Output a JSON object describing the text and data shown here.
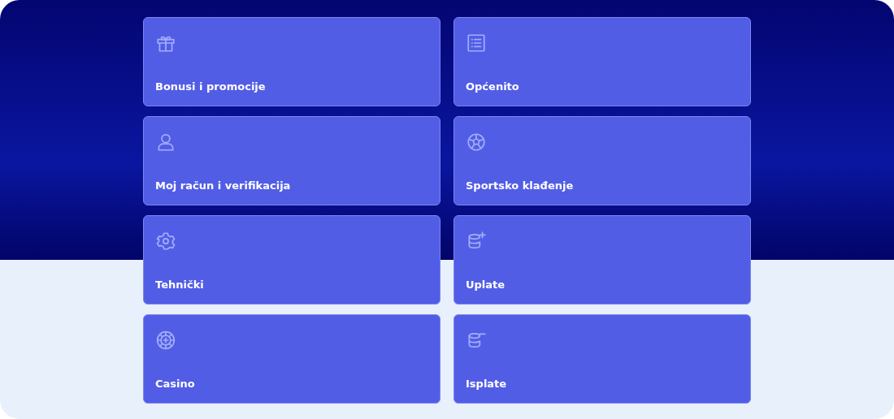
{
  "categories": [
    {
      "label": "Bonusi i promocije"
    },
    {
      "label": "Općenito"
    },
    {
      "label": "Moj račun i verifikacija"
    },
    {
      "label": "Sportsko klađenje"
    },
    {
      "label": "Tehnički"
    },
    {
      "label": "Uplate"
    },
    {
      "label": "Casino"
    },
    {
      "label": "Isplate"
    }
  ]
}
